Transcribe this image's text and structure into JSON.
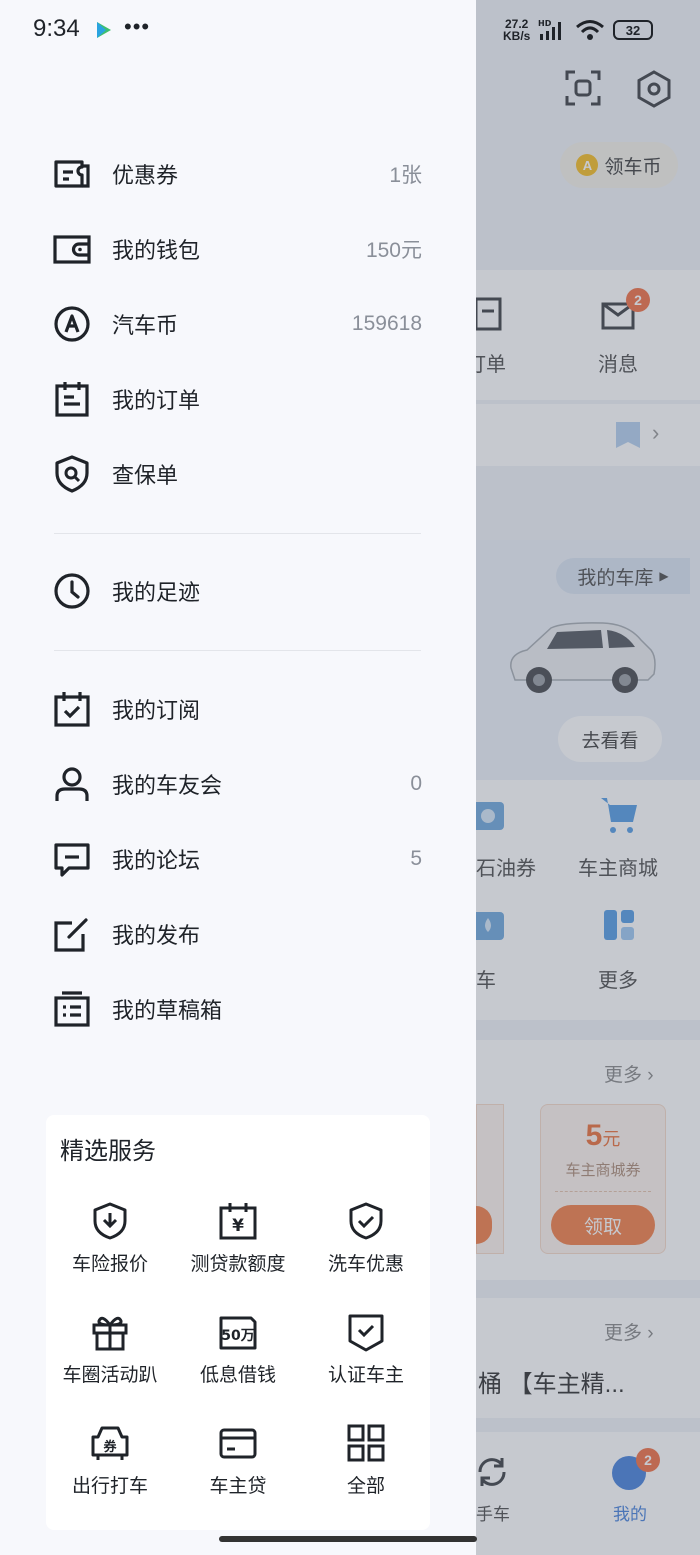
{
  "status_bar": {
    "time": "9:34",
    "net_speed_top": "27.2",
    "net_speed_bottom": "KB/s",
    "battery": "32"
  },
  "drawer": {
    "menu": [
      {
        "label": "优惠券",
        "value": "1张",
        "icon": "coupon-icon"
      },
      {
        "label": "我的钱包",
        "value": "150元",
        "icon": "wallet-icon"
      },
      {
        "label": "汽车币",
        "value": "159618",
        "icon": "coin-icon"
      },
      {
        "label": "我的订单",
        "value": "",
        "icon": "order-icon"
      },
      {
        "label": "查保单",
        "value": "",
        "icon": "policy-icon"
      }
    ],
    "footprint": {
      "label": "我的足迹",
      "icon": "clock-icon"
    },
    "menu2": [
      {
        "label": "我的订阅",
        "value": "",
        "icon": "calendar-check-icon"
      },
      {
        "label": "我的车友会",
        "value": "0",
        "icon": "user-icon"
      },
      {
        "label": "我的论坛",
        "value": "5",
        "icon": "chat-icon"
      },
      {
        "label": "我的发布",
        "value": "",
        "icon": "edit-icon"
      },
      {
        "label": "我的草稿箱",
        "value": "",
        "icon": "draft-icon"
      }
    ],
    "services": {
      "title": "精选服务",
      "items": [
        {
          "label": "车险报价",
          "icon": "shield-download-icon"
        },
        {
          "label": "测贷款额度",
          "icon": "calendar-yen-icon"
        },
        {
          "label": "洗车优惠",
          "icon": "shield-check-icon"
        },
        {
          "label": "车圈活动趴",
          "icon": "gift-icon"
        },
        {
          "label": "低息借钱",
          "icon": "50wan-icon"
        },
        {
          "label": "认证车主",
          "icon": "badge-check-icon"
        },
        {
          "label": "出行打车",
          "icon": "car-coupon-icon"
        },
        {
          "label": "车主贷",
          "icon": "card-icon"
        },
        {
          "label": "全部",
          "icon": "grid-icon"
        }
      ],
      "icon_glyphs": {
        "coupon": "券",
        "yen": "¥",
        "fifty": "50万"
      }
    }
  },
  "background": {
    "coin_button": "领车币",
    "coin_badge_letter": "A",
    "orders_label": "订单",
    "messages_label": "消息",
    "messages_badge": "2",
    "garage_label": "我的车库",
    "go_look": "去看看",
    "oil_coupon": "石油券",
    "mall": "车主商城",
    "car_label": "车",
    "more": "更多",
    "more_link": "更多",
    "coupon_amount": "5",
    "coupon_unit": "元",
    "coupon_desc": "车主商城券",
    "claim": "领取",
    "more_link2": "更多",
    "headline": "桶 【车主精...",
    "used_car": "手车",
    "mine": "我的",
    "mine_badge": "2"
  },
  "colors": {
    "accent_orange": "#f05a28",
    "tab_blue": "#2b6fd6",
    "drawer_bg": "#f7f8fc"
  }
}
